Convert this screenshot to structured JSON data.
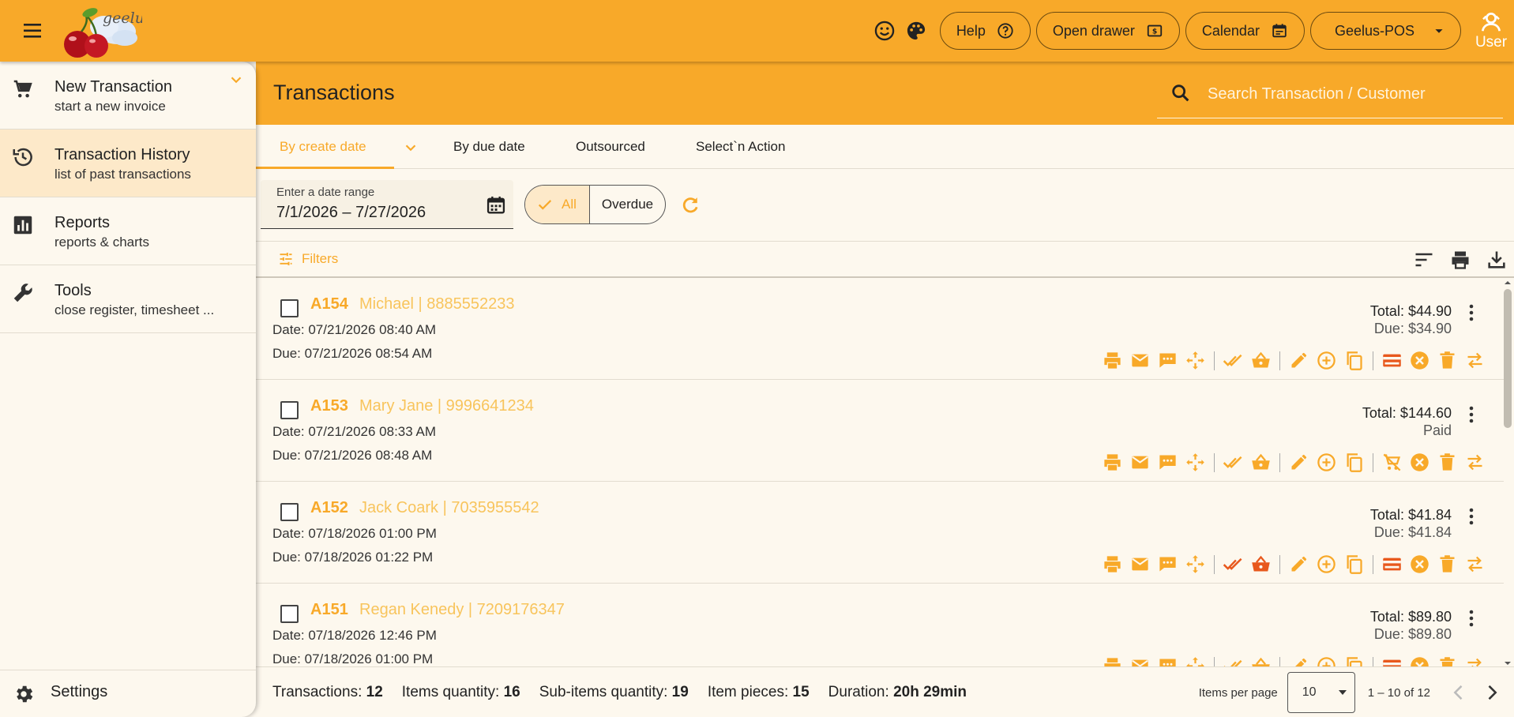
{
  "header": {
    "logo_text": "geelus",
    "help_label": "Help",
    "open_drawer_label": "Open drawer",
    "calendar_label": "Calendar",
    "store_label": "Geelus-POS",
    "user_label": "User"
  },
  "sidebar": {
    "items": [
      {
        "title": "New Transaction",
        "subtitle": "start a new invoice",
        "icon": "cart-icon"
      },
      {
        "title": "Transaction History",
        "subtitle": "list of past transactions",
        "icon": "history-icon"
      },
      {
        "title": "Reports",
        "subtitle": "reports & charts",
        "icon": "chart-icon"
      },
      {
        "title": "Tools",
        "subtitle": "close register, timesheet ...",
        "icon": "wrench-icon"
      }
    ],
    "settings_label": "Settings"
  },
  "main": {
    "title": "Transactions",
    "search_placeholder": "Search Transaction / Customer",
    "tabs": [
      {
        "label": "By create date",
        "active": true
      },
      {
        "label": "By due date"
      },
      {
        "label": "Outsourced"
      },
      {
        "label": "Select`n Action"
      }
    ],
    "date_range": {
      "label": "Enter a date range",
      "value": "7/1/2026  – 7/27/2026"
    },
    "filter_all": "All",
    "filter_overdue": "Overdue",
    "filters_label": "Filters"
  },
  "transactions": [
    {
      "id": "A154",
      "customer": "Michael | 8885552233",
      "date": "Date: 07/21/2026 08:40 AM",
      "due": "Due: 07/21/2026 08:54 AM",
      "total": "Total: $44.90",
      "due_amount": "Due: $34.90"
    },
    {
      "id": "A153",
      "customer": "Mary Jane | 9996641234",
      "date": "Date: 07/21/2026 08:33 AM",
      "due": "Due: 07/21/2026 08:48 AM",
      "total": "Total: $144.60",
      "due_amount": "Paid"
    },
    {
      "id": "A152",
      "customer": "Jack Coark | 7035955542",
      "date": "Date: 07/18/2026 01:00 PM",
      "due": "Due: 07/18/2026 01:22 PM",
      "total": "Total: $41.84",
      "due_amount": "Due: $41.84"
    },
    {
      "id": "A151",
      "customer": "Regan Kenedy | 7209176347",
      "date": "Date: 07/18/2026 12:46 PM",
      "due": "Due: 07/18/2026 01:00 PM",
      "total": "Total: $89.80",
      "due_amount": "Due: $89.80"
    }
  ],
  "footer": {
    "transactions_label": "Transactions:",
    "transactions_value": "12",
    "items_label": "Items quantity:",
    "items_value": "16",
    "subitems_label": "Sub-items quantity:",
    "subitems_value": "19",
    "pieces_label": "Item pieces:",
    "pieces_value": "15",
    "duration_label": "Duration:",
    "duration_value": "20h 29min",
    "items_per_page_label": "Items per page",
    "items_per_page_value": "10",
    "range_label": "1 – 10 of 12"
  },
  "colors": {
    "accent": "#f8a929",
    "active_bg": "#fde9c9",
    "background": "#fdf8ee",
    "alert": "#e8581c"
  }
}
